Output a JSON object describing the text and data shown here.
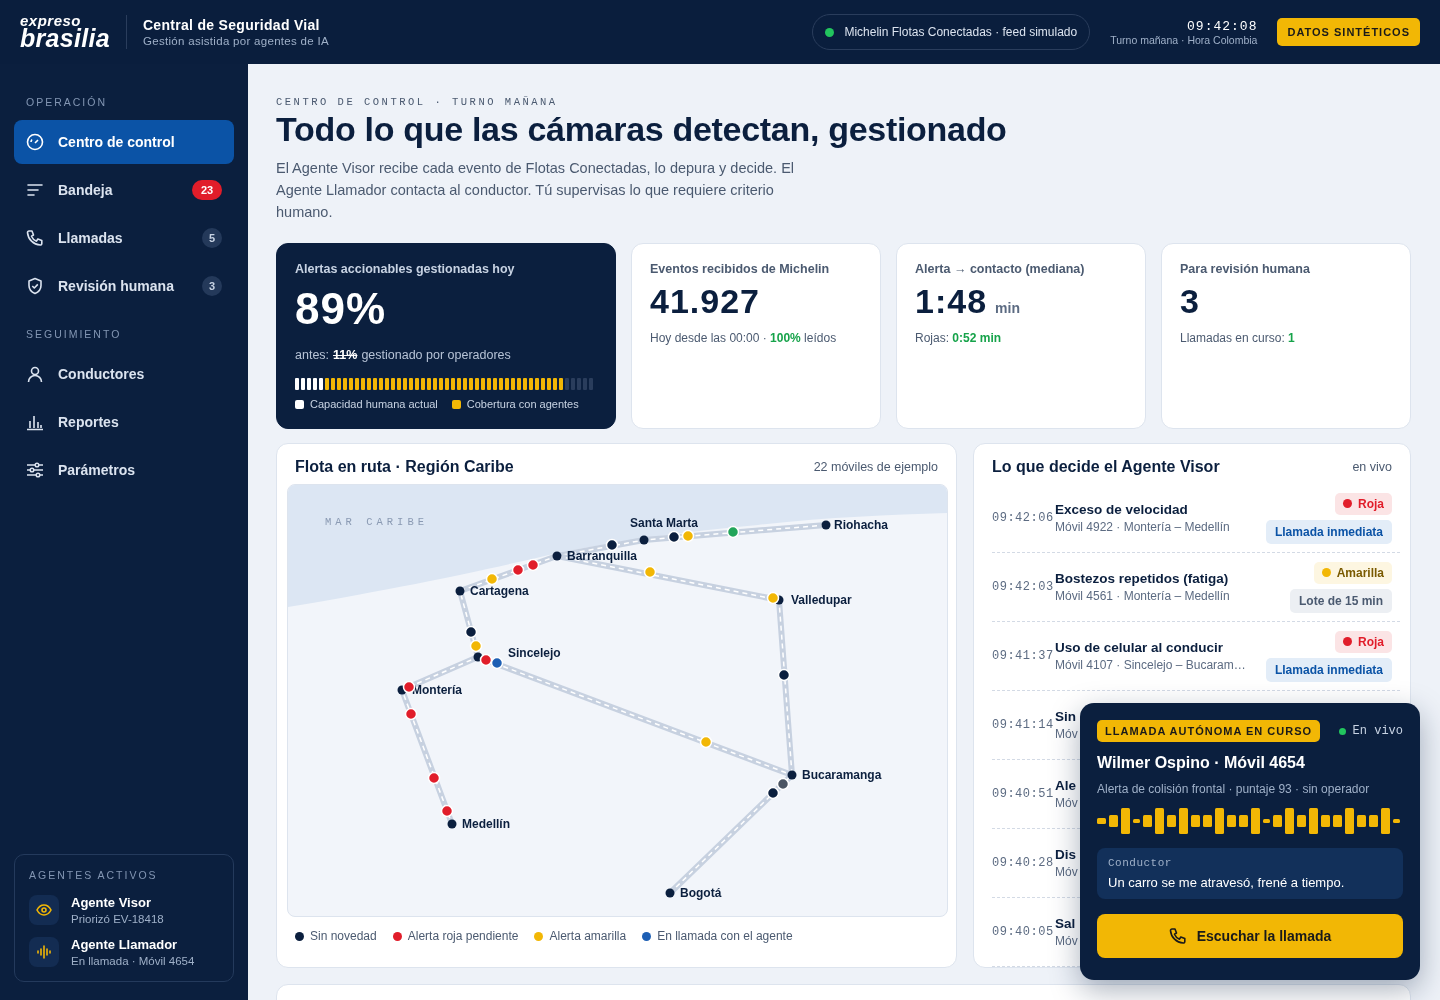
{
  "header": {
    "logo_top": "expreso",
    "logo_bottom": "brasilia",
    "title": "Central de Seguridad Vial",
    "subtitle": "Gestión asistida por agentes de IA",
    "feed": {
      "label": "Michelin Flotas Conectadas · feed simulado",
      "color": "#22c55e"
    },
    "clock": "09:42:08",
    "shift": "Turno mañana · Hora Colombia",
    "badge": "DATOS SINTÉTICOS"
  },
  "sidebar": {
    "sections": [
      {
        "title": "OPERACIÓN",
        "items": [
          {
            "label": "Centro de control",
            "selected": true
          },
          {
            "label": "Bandeja",
            "count": "23",
            "urgent": true,
            "selected": false
          },
          {
            "label": "Llamadas",
            "count": "5",
            "urgent": false,
            "selected": false
          },
          {
            "label": "Revisión humana",
            "count": "3",
            "urgent": false,
            "selected": false
          }
        ]
      },
      {
        "title": "SEGUIMIENTO",
        "items": [
          {
            "label": "Conductores",
            "selected": false
          },
          {
            "label": "Reportes",
            "selected": false
          },
          {
            "label": "Parámetros",
            "selected": false
          }
        ]
      }
    ],
    "agents": {
      "title": "AGENTES ACTIVOS",
      "items": [
        {
          "name": "Agente Visor",
          "status": "Priorizó EV-18418"
        },
        {
          "name": "Agente Llamador",
          "status": "En llamada · Móvil 4654"
        }
      ]
    }
  },
  "hero": {
    "eyebrow": "CENTRO DE CONTROL · TURNO MAÑANA",
    "title": "Todo lo que las cámaras detectan, gestionado",
    "description": "El Agente Visor recibe cada evento de Flotas Conectadas, lo depura y decide. El Agente Llamador contacta al conductor. Tú supervisas lo que requiere criterio humano."
  },
  "stats": [
    {
      "kind": "meter",
      "label": "Alertas accionables gestionadas hoy",
      "value": "89%",
      "before_label": "antes:",
      "before_value": "11%",
      "before_rest": "gestionado por operadores",
      "legend": [
        {
          "label": "Capacidad humana actual",
          "color": "#ffffff"
        },
        {
          "label": "Cobertura con agentes",
          "color": "#f2b705"
        }
      ]
    },
    {
      "kind": "plain",
      "label": "Eventos recibidos de Michelin",
      "value": "41.927",
      "note": "Hoy desde las 00:00 · **100%** leídos"
    },
    {
      "kind": "plain",
      "label": "Alerta → contacto (mediana)",
      "value": "1:48",
      "unit": "min",
      "note": "Rojas: **0:52 min**"
    },
    {
      "kind": "plain",
      "label": "Para revisión humana",
      "value": "3",
      "note": "Llamadas en curso: **1**"
    }
  ],
  "fleet": {
    "title": "Flota en ruta · Región Caribe",
    "count": "22 móviles de ejemplo",
    "map": {
      "sea_label": "MAR CARIBE",
      "cities": [
        {
          "name": "Riohacha"
        },
        {
          "name": "Santa Marta"
        },
        {
          "name": "Barranquilla"
        },
        {
          "name": "Cartagena"
        },
        {
          "name": "Valledupar"
        },
        {
          "name": "Sincelejo"
        },
        {
          "name": "Montería"
        },
        {
          "name": "Medellín"
        },
        {
          "name": "Bucaramanga"
        },
        {
          "name": "Bogotá"
        }
      ],
      "vehicles": [
        {
          "color": "#f2b705"
        },
        {
          "color": "#0b1f3e"
        },
        {
          "color": "#22a55a"
        },
        {
          "color": "#0b1f3e"
        },
        {
          "color": "#f2b705"
        },
        {
          "color": "#e11d2a"
        },
        {
          "color": "#e11d2a"
        },
        {
          "color": "#f2b705"
        },
        {
          "color": "#0b1f3e"
        },
        {
          "color": "#f2b705"
        },
        {
          "color": "#e11d2a"
        },
        {
          "color": "#1d5fb4"
        },
        {
          "color": "#e11d2a"
        },
        {
          "color": "#e11d2a"
        },
        {
          "color": "#e11d2a"
        },
        {
          "color": "#e11d2a"
        },
        {
          "color": "#f2b705"
        },
        {
          "color": "#0b1f3e"
        },
        {
          "color": "#f2b705"
        },
        {
          "color": "#4b5563"
        },
        {
          "color": "#0b1f3e"
        }
      ]
    },
    "legend": [
      {
        "label": "Sin novedad",
        "color": "#0b1f3e"
      },
      {
        "label": "Alerta roja pendiente",
        "color": "#e11d2a"
      },
      {
        "label": "Alerta amarilla",
        "color": "#f2b705"
      },
      {
        "label": "En llamada con el agente",
        "color": "#1d5fb4"
      }
    ]
  },
  "decisions": {
    "title": "Lo que decide el Agente Visor",
    "status": "en vivo",
    "rows": [
      {
        "time": "09:42:06",
        "title": "Exceso de velocidad",
        "detail": "Móvil 4922 · Montería – Medellín",
        "severity": {
          "label": "Roja",
          "color": "#e11d2a"
        },
        "action": {
          "label": "Llamada inmediata",
          "kind": "call"
        }
      },
      {
        "time": "09:42:03",
        "title": "Bostezos repetidos (fatiga)",
        "detail": "Móvil 4561 · Montería – Medellín",
        "severity": {
          "label": "Amarilla",
          "color": "#f2b705"
        },
        "action": {
          "label": "Lote de 15 min",
          "kind": "batch"
        }
      },
      {
        "time": "09:41:37",
        "title": "Uso de celular al conducir",
        "detail": "Móvil 4107 · Sincelejo – Bucaram…",
        "severity": {
          "label": "Roja",
          "color": "#e11d2a"
        },
        "action": {
          "label": "Llamada inmediata",
          "kind": "call"
        }
      },
      {
        "time": "09:41:14",
        "title": "Sin",
        "detail": "Móv"
      },
      {
        "time": "09:40:51",
        "title": "Ale",
        "detail": "Móv"
      },
      {
        "time": "09:40:28",
        "title": "Dis",
        "detail": "Móv"
      },
      {
        "time": "09:40:05",
        "title": "Sal",
        "detail": "Móv"
      }
    ]
  },
  "call": {
    "tag": "LLAMADA AUTÓNOMA EN CURSO",
    "live": "En vivo",
    "title": "Wilmer Ospino · Móvil 4654",
    "detail": "Alerta de colisión frontal · puntaje 93 · sin operador",
    "speaker": "Conductor",
    "quote": "Un carro se me atravesó, frené a tiempo.",
    "button": "Escuchar la llamada"
  }
}
